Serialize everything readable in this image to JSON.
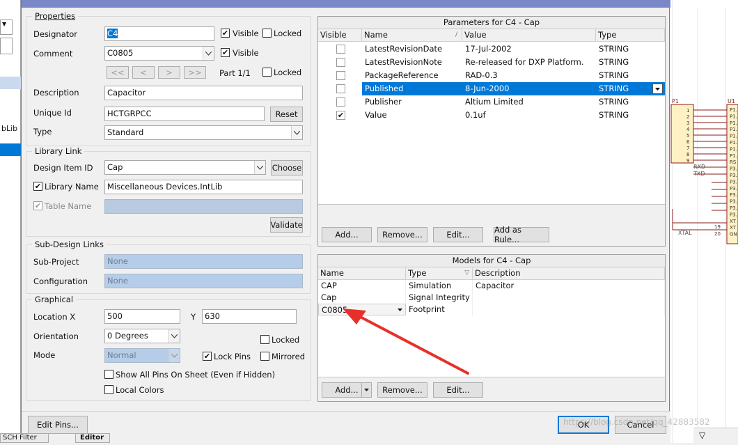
{
  "left_strip": {
    "box1": "▼",
    "box2": "",
    "item_label": "bLib"
  },
  "right_schematic": {
    "p1_label": "P1",
    "u1_label": "U1",
    "pins": [
      "1",
      "2",
      "3",
      "4",
      "5",
      "6",
      "7",
      "8",
      "9"
    ],
    "u_pins": [
      "P1.",
      "P1.",
      "P1.",
      "P1.",
      "P1.",
      "P1.",
      "P1.",
      "P1.",
      "RS",
      "P3.",
      "P3.",
      "P3.",
      "P3.",
      "P3.",
      "P3.",
      "P3.",
      "P3.",
      "XT",
      "XT",
      "GN"
    ],
    "rxd": "RXD",
    "txd": "TXD",
    "xtal": "XTAL",
    "pin19": "19",
    "pin20": "20"
  },
  "properties": {
    "group_title": "Properties",
    "designator_label": "Designator",
    "designator_value": "C4",
    "visible_label": "Visible",
    "locked_label": "Locked",
    "comment_label": "Comment",
    "comment_value": "C0805",
    "part_label": "Part 1/1",
    "nav_first": "<<",
    "nav_prev": "<",
    "nav_next": ">",
    "nav_last": ">>",
    "description_label": "Description",
    "description_value": "Capacitor",
    "unique_id_label": "Unique Id",
    "unique_id_value": "HCTGRPCC",
    "reset_label": "Reset",
    "type_label": "Type",
    "type_value": "Standard"
  },
  "library_link": {
    "group_title": "Library Link",
    "design_item_label": "Design Item ID",
    "design_item_value": "Cap",
    "choose_label": "Choose",
    "library_name_label": "Library Name",
    "library_name_value": "Miscellaneous Devices.IntLib",
    "table_name_label": "Table Name",
    "validate_label": "Validate"
  },
  "sub_design": {
    "group_title": "Sub-Design Links",
    "sub_project_label": "Sub-Project",
    "sub_project_value": "None",
    "configuration_label": "Configuration",
    "configuration_value": "None"
  },
  "graphical": {
    "group_title": "Graphical",
    "location_label": "Location  X",
    "x_value": "500",
    "y_label": "Y",
    "y_value": "630",
    "orientation_label": "Orientation",
    "orientation_value": "0 Degrees",
    "locked_label": "Locked",
    "mode_label": "Mode",
    "mode_value": "Normal",
    "lock_pins_label": "Lock Pins",
    "mirrored_label": "Mirrored",
    "show_all_pins_label": "Show All Pins On Sheet (Even if Hidden)",
    "local_colors_label": "Local Colors"
  },
  "parameters": {
    "title": "Parameters for C4 - Cap",
    "columns": [
      "Visible",
      "Name",
      "Value",
      "Type"
    ],
    "rows": [
      {
        "visible": false,
        "name": "LatestRevisionDate",
        "value": "17-Jul-2002",
        "type": "STRING"
      },
      {
        "visible": false,
        "name": "LatestRevisionNote",
        "value": "Re-released for DXP Platform.",
        "type": "STRING"
      },
      {
        "visible": false,
        "name": "PackageReference",
        "value": "RAD-0.3",
        "type": "STRING"
      },
      {
        "visible": false,
        "name": "Published",
        "value": "8-Jun-2000",
        "type": "STRING"
      },
      {
        "visible": false,
        "name": "Publisher",
        "value": "Altium Limited",
        "type": "STRING"
      },
      {
        "visible": true,
        "name": "Value",
        "value": "0.1uf",
        "type": "STRING"
      }
    ],
    "add_label": "Add...",
    "remove_label": "Remove...",
    "edit_label": "Edit...",
    "add_as_rule_label": "Add as Rule..."
  },
  "models": {
    "title": "Models for C4 - Cap",
    "columns": [
      "Name",
      "Type",
      "Description"
    ],
    "rows": [
      {
        "name": "CAP",
        "type": "Simulation",
        "description": "Capacitor"
      },
      {
        "name": "Cap",
        "type": "Signal Integrity",
        "description": ""
      },
      {
        "name": "C0805",
        "type": "Footprint",
        "description": ""
      }
    ],
    "add_label": "Add...",
    "remove_label": "Remove...",
    "edit_label": "Edit..."
  },
  "footer": {
    "edit_pins_label": "Edit Pins...",
    "ok_label": "OK",
    "cancel_label": "Cancel",
    "watermark": "https://blog.csdn.net/qq_42883582",
    "tab1": "SCH Filter",
    "tab2": "Editor"
  },
  "colors": {
    "selection": "#0078d7",
    "arrow": "#e8302a",
    "schematic_red": "#8b1a1a"
  }
}
